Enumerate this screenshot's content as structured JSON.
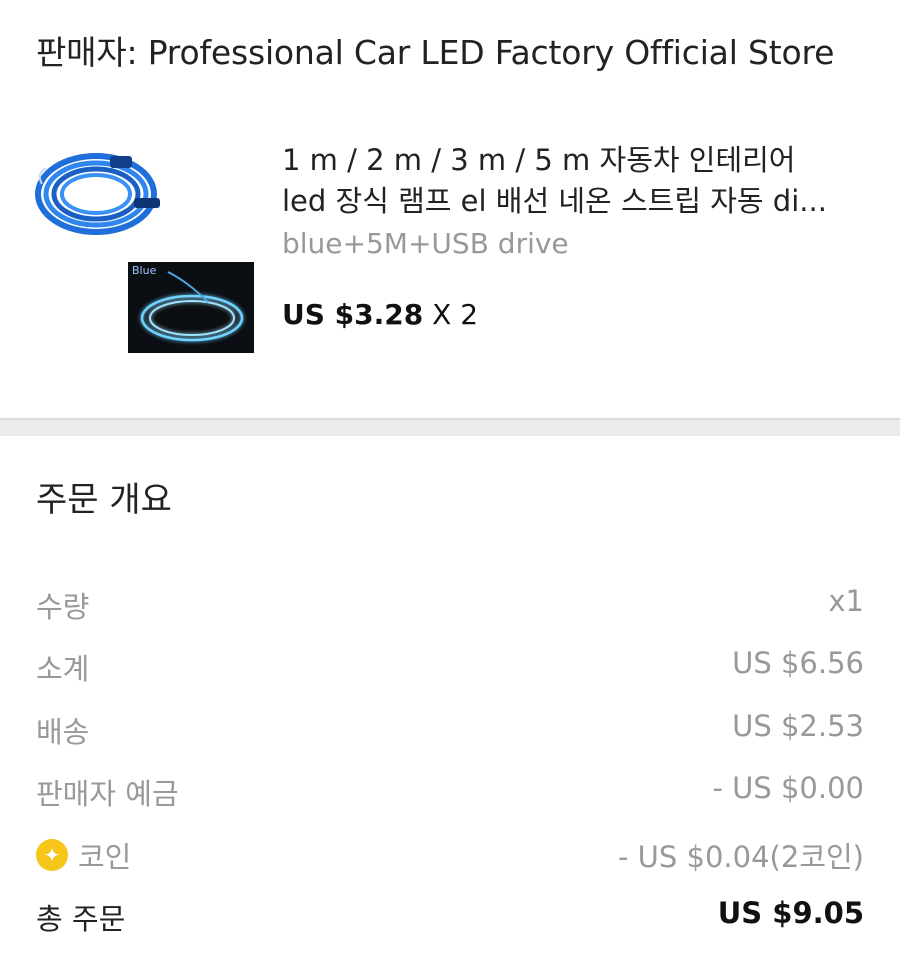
{
  "seller": {
    "text": "판매자: Professional Car LED Factory Official Store"
  },
  "product": {
    "title_line1": "1 m / 2 m / 3 m / 5 m 자동차 인테리어",
    "title_line2": "led 장식 램프 el 배선 네온 스트립 자동 di...",
    "variant": "blue+5M+USB drive",
    "price": "US $3.28",
    "quantity_text": " X 2",
    "thumb_tag": "Blue"
  },
  "summary": {
    "title": "주문 개요",
    "rows": [
      {
        "label": "수량",
        "value": "x1"
      },
      {
        "label": "소계",
        "value": "US $6.56"
      },
      {
        "label": "배송",
        "value": "US $2.53"
      },
      {
        "label": "판매자 예금",
        "value": "- US $0.00"
      },
      {
        "label": "코인",
        "value": "- US $0.04(2코인)",
        "icon": "coin-icon"
      },
      {
        "label": "총 주문",
        "value": "US $9.05"
      }
    ]
  },
  "colors": {
    "coin": "#f5c518",
    "muted_text": "#999999",
    "divider": "#ececec"
  }
}
